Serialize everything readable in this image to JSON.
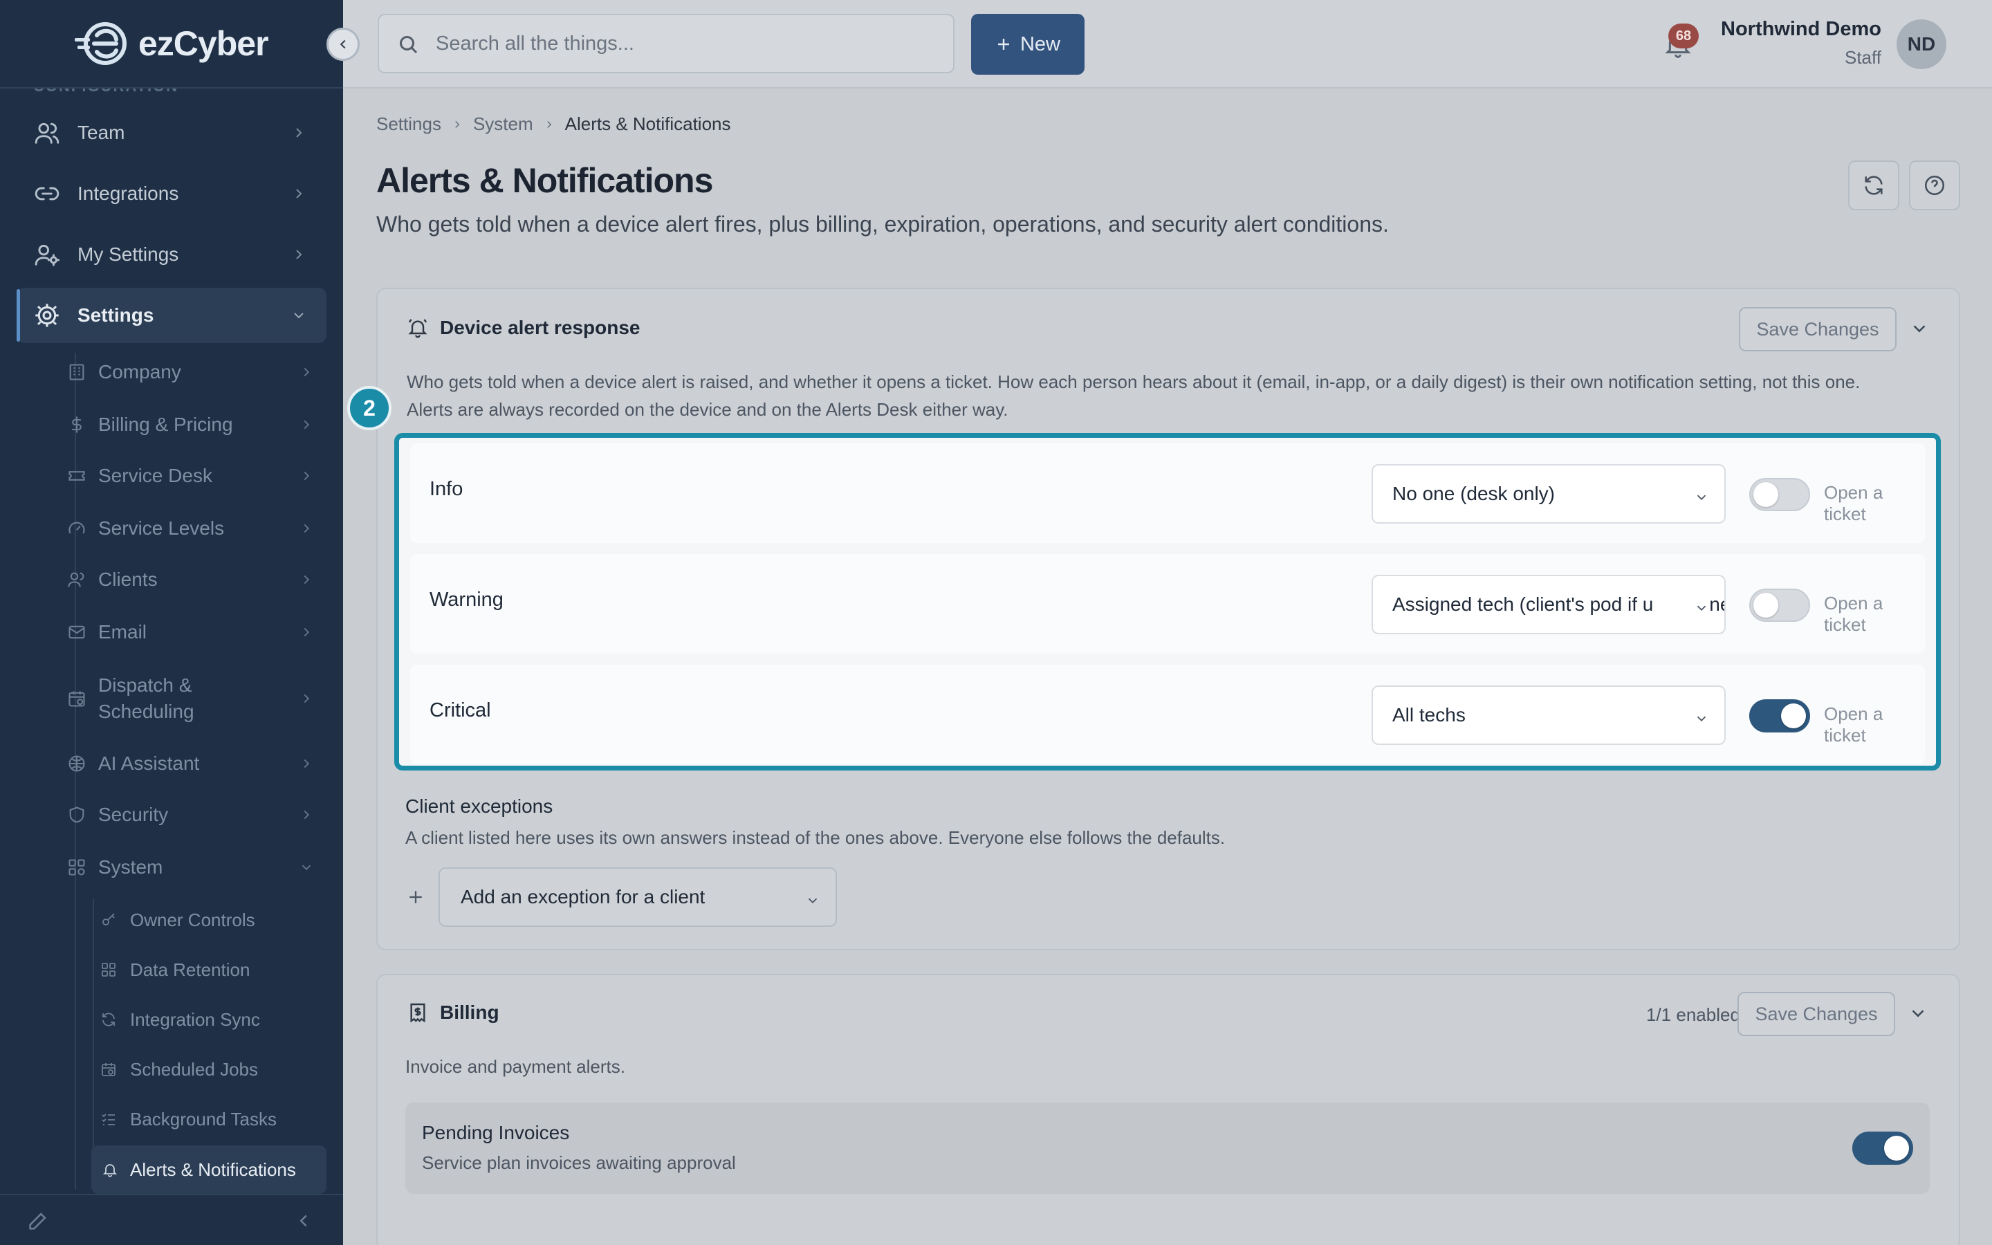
{
  "brand": {
    "logo_text": "ezCyber"
  },
  "sidebar": {
    "section_label": "CONFIGURATION",
    "top_items": [
      {
        "label": "Team",
        "icon": "users-icon"
      },
      {
        "label": "Integrations",
        "icon": "link-icon"
      },
      {
        "label": "My Settings",
        "icon": "user-gear-icon"
      },
      {
        "label": "Settings",
        "icon": "gear-icon",
        "active": true
      }
    ],
    "settings_items": [
      {
        "label": "Company",
        "icon": "building-icon"
      },
      {
        "label": "Billing & Pricing",
        "icon": "dollar-icon"
      },
      {
        "label": "Service Desk",
        "icon": "ticket-icon"
      },
      {
        "label": "Service Levels",
        "icon": "gauge-icon"
      },
      {
        "label": "Clients",
        "icon": "users-icon"
      },
      {
        "label": "Email",
        "icon": "mail-icon"
      },
      {
        "label": "Dispatch & Scheduling",
        "label_lines": [
          "Dispatch &",
          "Scheduling"
        ],
        "icon": "calendar-icon"
      },
      {
        "label": "AI Assistant",
        "icon": "brain-icon"
      },
      {
        "label": "Security",
        "icon": "shield-icon"
      },
      {
        "label": "System",
        "icon": "grid-icon",
        "expanded": true
      }
    ],
    "system_items": [
      {
        "label": "Owner Controls",
        "icon": "key-icon"
      },
      {
        "label": "Data Retention",
        "icon": "grid-icon"
      },
      {
        "label": "Integration Sync",
        "icon": "refresh-icon"
      },
      {
        "label": "Scheduled Jobs",
        "icon": "calendar-clock-icon"
      },
      {
        "label": "Background Tasks",
        "icon": "list-check-icon"
      },
      {
        "label": "Alerts & Notifications",
        "icon": "bell-icon",
        "active": true
      }
    ]
  },
  "topbar": {
    "search_placeholder": "Search all the things...",
    "new_label": "New",
    "notification_count": "68",
    "user_name": "Northwind Demo",
    "user_role": "Staff",
    "avatar_initials": "ND"
  },
  "breadcrumb": [
    "Settings",
    "System",
    "Alerts & Notifications"
  ],
  "page": {
    "title": "Alerts & Notifications",
    "subtitle": "Who gets told when a device alert fires, plus billing, expiration, operations, and security alert conditions."
  },
  "device_alert": {
    "title": "Device alert response",
    "save_label": "Save Changes",
    "description_lines": [
      "Who gets told when a device alert is raised, and whether it opens a ticket. How each person hears about it (email, in-app, or a daily digest) is their own notification setting, not this one.",
      "Alerts are always recorded on the device and on the Alerts Desk either way."
    ],
    "step_number": "2",
    "rows": [
      {
        "level": "Info",
        "recipient": "No one (desk only)",
        "ticket_label": "Open a ticket",
        "ticket_on": false
      },
      {
        "level": "Warning",
        "recipient": "Assigned tech (client's pod if unassigned)",
        "ticket_label": "Open a ticket",
        "ticket_on": false
      },
      {
        "level": "Critical",
        "recipient": "All techs",
        "ticket_label": "Open a ticket",
        "ticket_on": true
      }
    ],
    "exceptions": {
      "title": "Client exceptions",
      "description": "A client listed here uses its own answers instead of the ones above. Everyone else follows the defaults.",
      "add_label": "Add an exception for a client"
    }
  },
  "billing": {
    "title": "Billing",
    "enabled_count": "1/1 enabled",
    "save_label": "Save Changes",
    "description": "Invoice and payment alerts.",
    "items": [
      {
        "title": "Pending Invoices",
        "description": "Service plan invoices awaiting approval",
        "on": true
      }
    ]
  },
  "colors": {
    "sidebar_bg": "#1f3046",
    "accent": "#1b8ca8",
    "primary_button": "#33537f",
    "toggle_on": "#2d577d",
    "badge": "#9a4a45"
  }
}
